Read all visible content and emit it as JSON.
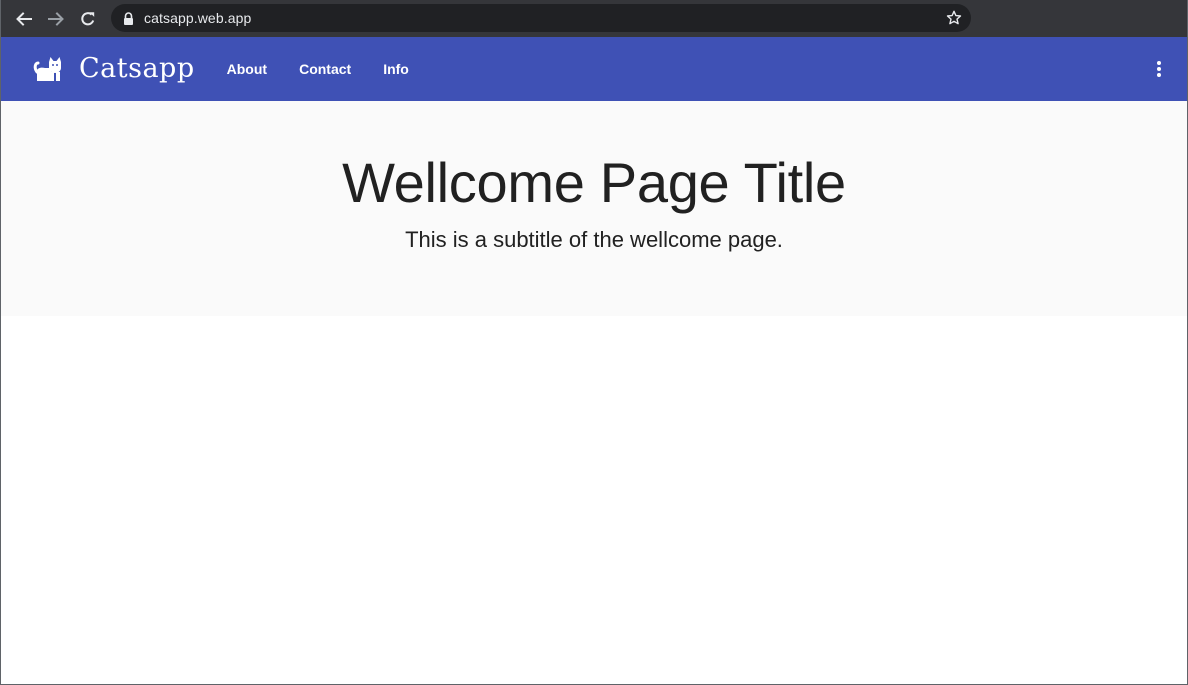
{
  "browser": {
    "url": "catsapp.web.app",
    "icons": {
      "back": "arrow-left-icon",
      "forward": "arrow-right-icon",
      "reload": "reload-icon",
      "secure": "lock-icon",
      "bookmark": "star-icon"
    }
  },
  "app_bar": {
    "brand": "Catsapp",
    "logo_icon": "cat-icon",
    "nav": [
      {
        "label": "About"
      },
      {
        "label": "Contact"
      },
      {
        "label": "Info"
      }
    ],
    "menu_icon": "more-vertical-icon",
    "color": "#3f51b5"
  },
  "hero": {
    "title": "Wellcome Page Title",
    "subtitle": "This is a subtitle of the wellcome page."
  },
  "colors": {
    "chrome_bg": "#35363a",
    "omnibox_bg": "#202124",
    "primary": "#3f51b5",
    "hero_bg": "#fafafa",
    "text": "#212121"
  }
}
